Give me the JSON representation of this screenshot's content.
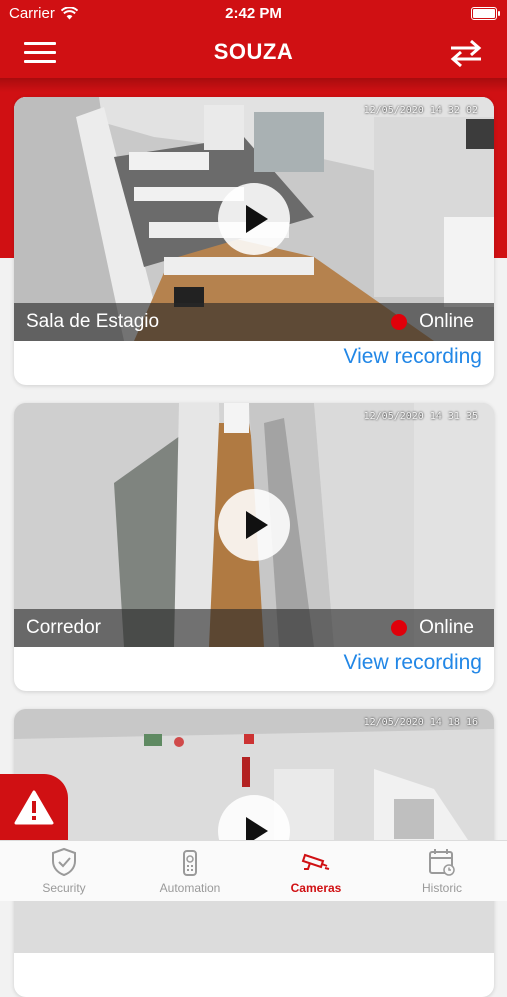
{
  "status_bar": {
    "carrier": "Carrier",
    "time": "2:42 PM"
  },
  "header": {
    "title": "SOUZA",
    "menu_icon": "hamburger-menu-icon",
    "switch_icon": "swap-arrows-icon"
  },
  "colors": {
    "brand_red": "#d01013",
    "link_blue": "#2287e6",
    "online_dot": "#e0000a"
  },
  "cameras": [
    {
      "name": "Sala de Estagio",
      "status": "Online",
      "action": "View recording",
      "timestamp": "12/05/2020 14 32 02"
    },
    {
      "name": "Corredor",
      "status": "Online",
      "action": "View recording",
      "timestamp": "12/05/2020 14 31 35"
    },
    {
      "name": "",
      "status": "",
      "action": "",
      "timestamp": "12/05/2020 14 18 16"
    }
  ],
  "tabs": [
    {
      "label": "Security",
      "icon": "shield-icon",
      "active": false
    },
    {
      "label": "Automation",
      "icon": "remote-control-icon",
      "active": false
    },
    {
      "label": "Cameras",
      "icon": "security-camera-icon",
      "active": true
    },
    {
      "label": "Historic",
      "icon": "calendar-icon",
      "active": false
    }
  ],
  "alert_button": {
    "icon": "warning-icon"
  }
}
